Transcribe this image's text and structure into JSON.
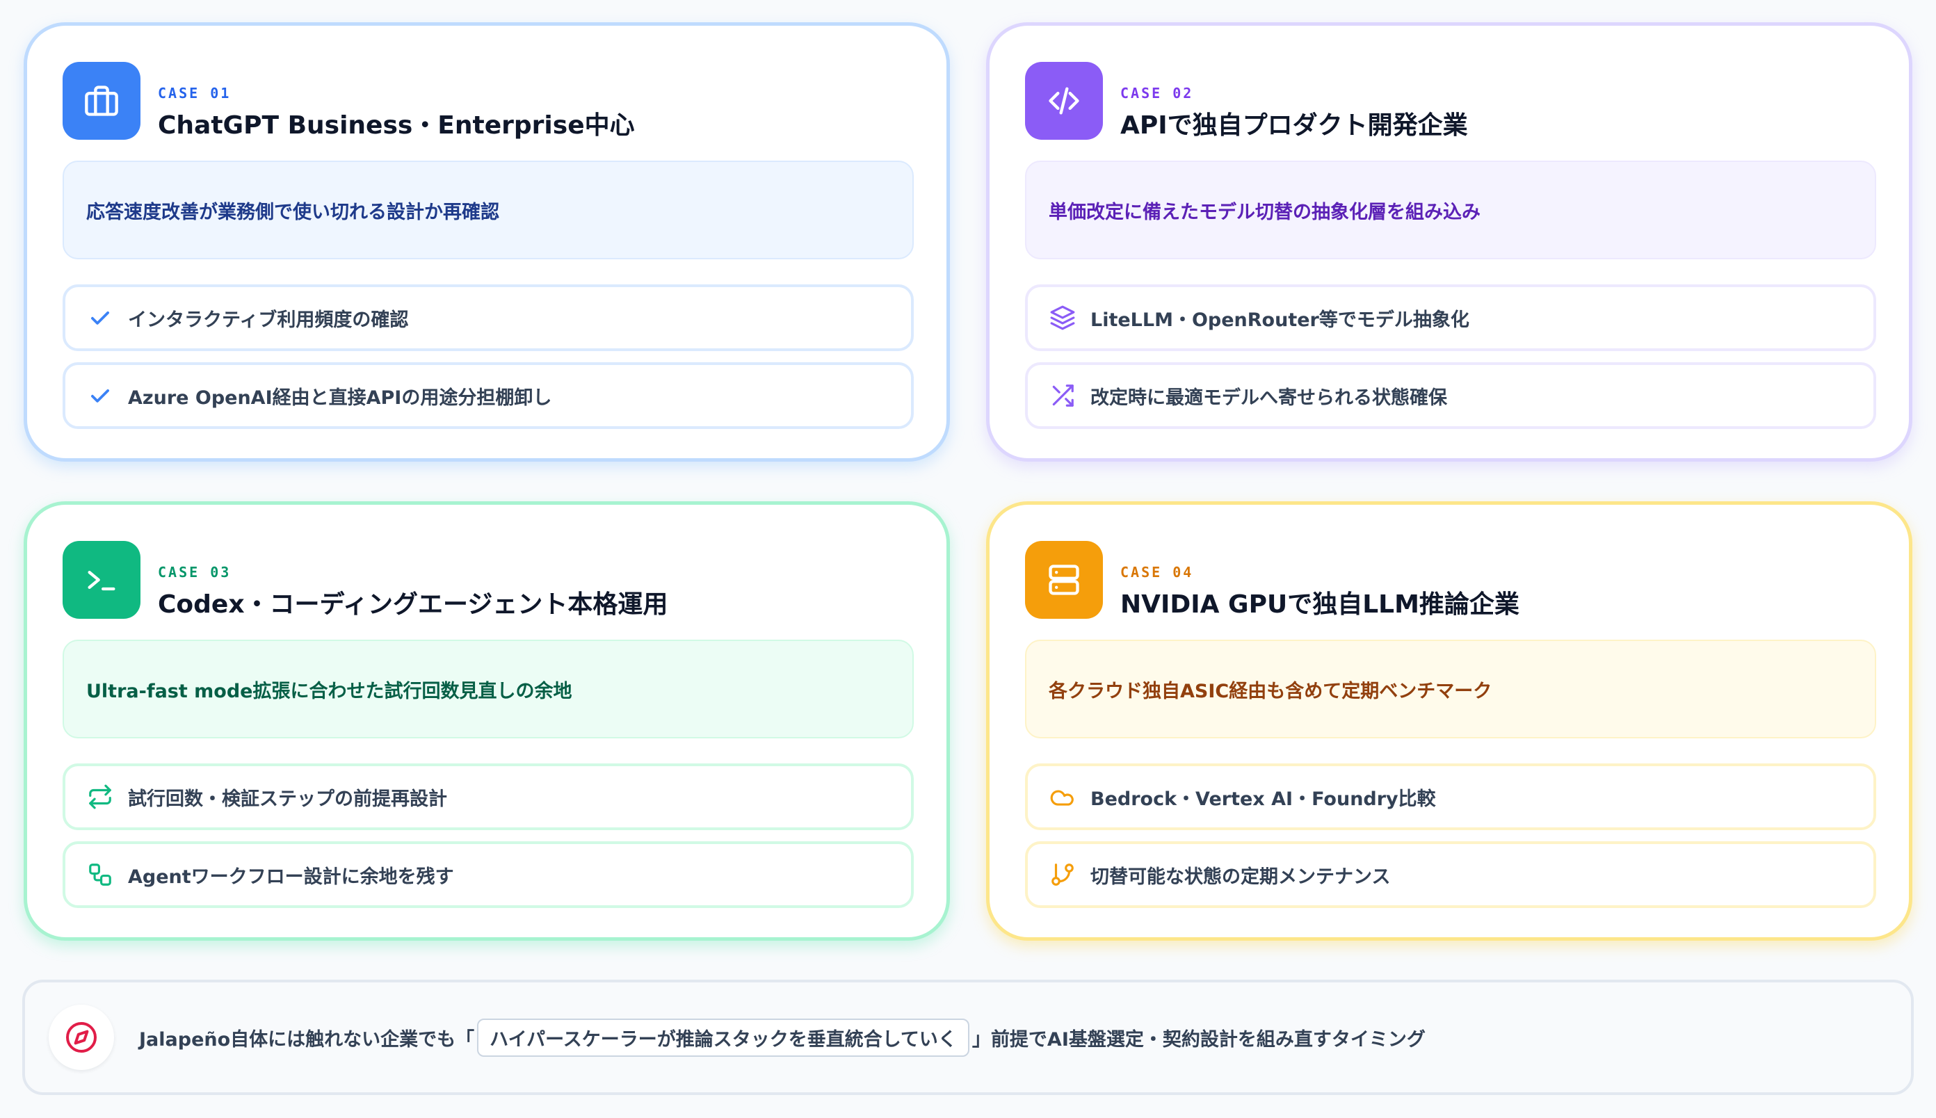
{
  "cards": [
    {
      "case_label": "CASE 01",
      "icon": "briefcase-icon",
      "accent": "#3b82f6",
      "title": "ChatGPT Business・Enterprise中心",
      "highlight": "応答速度改善が業務側で使い切れる設計か再確認",
      "items": [
        {
          "icon": "check-icon",
          "label": "インタラクティブ利用頻度の確認"
        },
        {
          "icon": "check-icon",
          "label": "Azure OpenAI経由と直接APIの用途分担棚卸し"
        }
      ]
    },
    {
      "case_label": "CASE 02",
      "icon": "code-icon",
      "accent": "#8b5cf6",
      "title": "APIで独自プロダクト開発企業",
      "highlight": "単価改定に備えたモデル切替の抽象化層を組み込み",
      "items": [
        {
          "icon": "layers-icon",
          "label": "LiteLLM・OpenRouter等でモデル抽象化"
        },
        {
          "icon": "shuffle-icon",
          "label": "改定時に最適モデルへ寄せられる状態確保"
        }
      ]
    },
    {
      "case_label": "CASE 03",
      "icon": "terminal-icon",
      "accent": "#10b981",
      "title": "Codex・コーディングエージェント本格運用",
      "highlight": "Ultra-fast mode拡張に合わせた試行回数見直しの余地",
      "items": [
        {
          "icon": "repeat-icon",
          "label": "試行回数・検証ステップの前提再設計"
        },
        {
          "icon": "workflow-icon",
          "label": "Agentワークフロー設計に余地を残す"
        }
      ]
    },
    {
      "case_label": "CASE 04",
      "icon": "server-icon",
      "accent": "#f59e0b",
      "title": "NVIDIA GPUで独自LLM推論企業",
      "highlight": "各クラウド独自ASIC経由も含めて定期ベンチマーク",
      "items": [
        {
          "icon": "cloud-icon",
          "label": "Bedrock・Vertex AI・Foundry比較"
        },
        {
          "icon": "git-branch-icon",
          "label": "切替可能な状態の定期メンテナンス"
        }
      ]
    }
  ],
  "footer": {
    "icon": "compass-icon",
    "text_before": "Jalapeño自体には触れない企業でも「",
    "chip": "ハイパースケーラーが推論スタックを垂直統合していく",
    "text_after": "」前提でAI基盤選定・契約設計を組み直すタイミング"
  }
}
